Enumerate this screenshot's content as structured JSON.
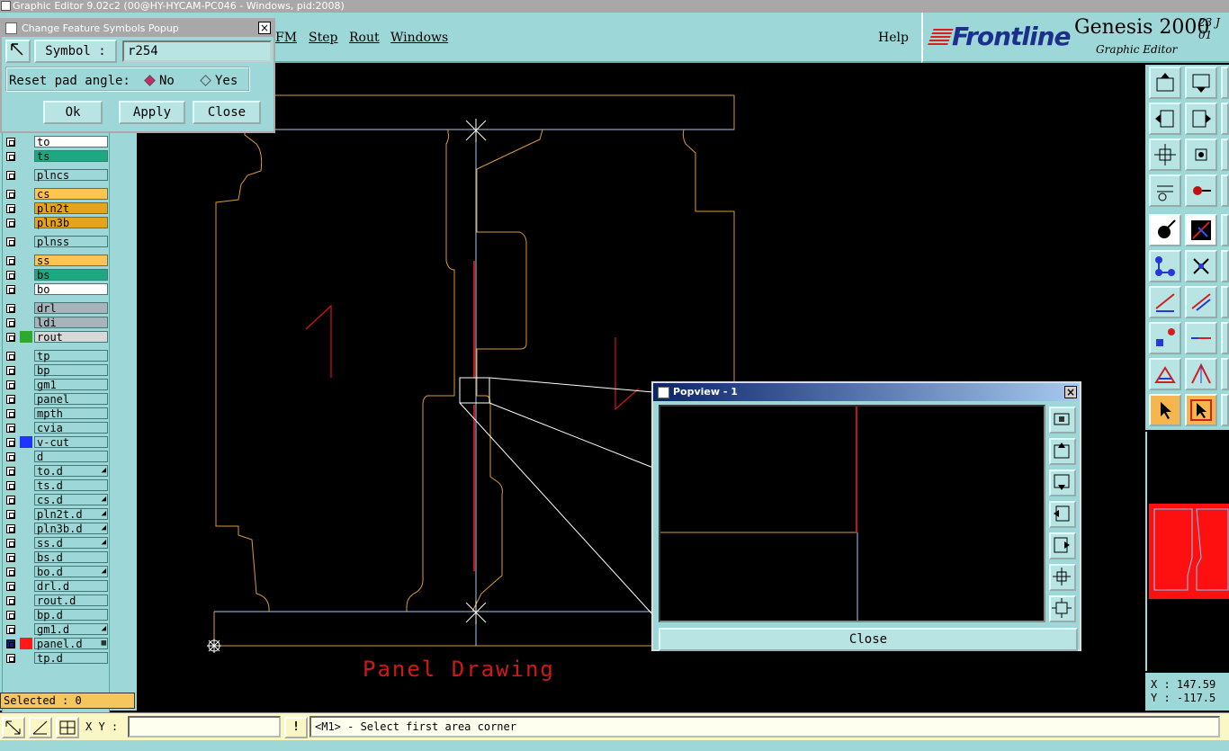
{
  "window": {
    "title": "Graphic Editor 9.02c2 (00@HY-HYCAM-PC046 - Windows, pid:2008)"
  },
  "menu": {
    "items": [
      "FM",
      "Step",
      "Rout",
      "Windows"
    ],
    "help": "Help"
  },
  "brand": {
    "logo": "Frontline",
    "product": "Genesis 2000",
    "subtitle": "Graphic Editor",
    "corner_top": "23 J",
    "corner_bottom": "01"
  },
  "symbols_popup": {
    "title": "Change Feature Symbols Popup",
    "symbol_label": "Symbol :",
    "symbol_value": "r254",
    "reset_label": "Reset pad angle:",
    "option_no": "No",
    "option_yes": "Yes",
    "selected_option": "No",
    "ok": "Ok",
    "apply": "Apply",
    "close": "Close"
  },
  "layers": [
    {
      "name": "to",
      "color": "#ffffff"
    },
    {
      "name": "ts",
      "color": "#1ea882"
    },
    {
      "name": "plncs",
      "color": "#9ed7d7"
    },
    {
      "name": "cs",
      "color": "#ffc454"
    },
    {
      "name": "pln2t",
      "color": "#e6a41c"
    },
    {
      "name": "pln3b",
      "color": "#e6a41c"
    },
    {
      "name": "plnss",
      "color": "#9ed7d7"
    },
    {
      "name": "ss",
      "color": "#ffc454"
    },
    {
      "name": "bs",
      "color": "#1ea882"
    },
    {
      "name": "bo",
      "color": "#ffffff"
    },
    {
      "name": "drl",
      "color": "#a8b4bc"
    },
    {
      "name": "ldi",
      "color": "#a8b4bc"
    },
    {
      "name": "rout",
      "color": "#d8d8d8",
      "swatch": "#2ea82e"
    },
    {
      "name": "tp",
      "color": "#9ed7d7"
    },
    {
      "name": "bp",
      "color": "#9ed7d7"
    },
    {
      "name": "gm1",
      "color": "#9ed7d7"
    },
    {
      "name": "panel",
      "color": "#9ed7d7"
    },
    {
      "name": "mpth",
      "color": "#9ed7d7"
    },
    {
      "name": "cvia",
      "color": "#9ed7d7"
    },
    {
      "name": "v-cut",
      "color": "#9ed7d7",
      "swatch": "#1f35ff"
    },
    {
      "name": "d",
      "color": "#9ed7d7"
    },
    {
      "name": "to.d",
      "color": "#9ed7d7",
      "flag": "◢"
    },
    {
      "name": "ts.d",
      "color": "#9ed7d7"
    },
    {
      "name": "cs.d",
      "color": "#9ed7d7",
      "flag": "◢"
    },
    {
      "name": "pln2t.d",
      "color": "#9ed7d7",
      "flag": "◢"
    },
    {
      "name": "pln3b.d",
      "color": "#9ed7d7",
      "flag": "◢"
    },
    {
      "name": "ss.d",
      "color": "#9ed7d7",
      "flag": "◢"
    },
    {
      "name": "bs.d",
      "color": "#9ed7d7"
    },
    {
      "name": "bo.d",
      "color": "#9ed7d7",
      "flag": "◢"
    },
    {
      "name": "drl.d",
      "color": "#9ed7d7"
    },
    {
      "name": "rout.d",
      "color": "#9ed7d7"
    },
    {
      "name": "bp.d",
      "color": "#9ed7d7"
    },
    {
      "name": "gm1.d",
      "color": "#9ed7d7",
      "flag": "◢"
    },
    {
      "name": "panel.d",
      "color": "#9ed7d7",
      "swatch": "#ff1a1a",
      "flag": "▦",
      "active": true
    },
    {
      "name": "tp.d",
      "color": "#9ed7d7"
    }
  ],
  "selected": "Selected : 0",
  "canvas": {
    "label": "Panel Drawing",
    "numeral_left": "1"
  },
  "popview": {
    "title": "Popview - 1",
    "close": "Close"
  },
  "coords": {
    "x": "X : 147.59",
    "y": "Y : -117.5"
  },
  "status": {
    "xy_label": "X Y :",
    "xy_value": "",
    "message": "<M1> - Select first area corner",
    "bang": "!"
  }
}
